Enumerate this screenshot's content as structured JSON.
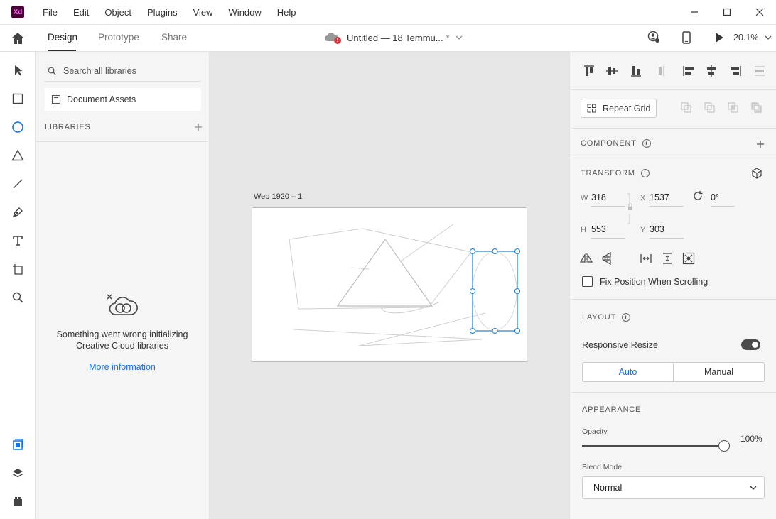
{
  "app": {
    "logo_text": "Xd"
  },
  "menu": [
    "File",
    "Edit",
    "Object",
    "Plugins",
    "View",
    "Window",
    "Help"
  ],
  "tabs": {
    "design": "Design",
    "prototype": "Prototype",
    "share": "Share"
  },
  "document": {
    "title": "Untitled — 18 Temmu...",
    "unsaved_marker": "*"
  },
  "zoom": "20.1%",
  "assets": {
    "search_placeholder": "Search all libraries",
    "document_assets": "Document Assets",
    "libraries_title": "LIBRARIES",
    "error_message": "Something went wrong initializing Creative Cloud libraries",
    "more_info": "More information"
  },
  "canvas": {
    "artboard_label": "Web 1920 – 1"
  },
  "inspector": {
    "repeat_grid": "Repeat Grid",
    "component_title": "COMPONENT",
    "transform_title": "TRANSFORM",
    "transform": {
      "w_label": "W",
      "w": "318",
      "h_label": "H",
      "h": "553",
      "x_label": "X",
      "x": "1537",
      "y_label": "Y",
      "y": "303",
      "rotation": "0°"
    },
    "fix_position": "Fix Position When Scrolling",
    "layout_title": "LAYOUT",
    "responsive_resize": "Responsive Resize",
    "responsive_resize_on": true,
    "resize_auto": "Auto",
    "resize_manual": "Manual",
    "appearance_title": "APPEARANCE",
    "opacity_label": "Opacity",
    "opacity_value": "100%",
    "blend_mode_label": "Blend Mode",
    "blend_mode": "Normal"
  },
  "colors": {
    "accent": "#1473e6",
    "selection": "#1b80d6",
    "brand_bg": "#470137",
    "brand_fg": "#ff61f6"
  }
}
